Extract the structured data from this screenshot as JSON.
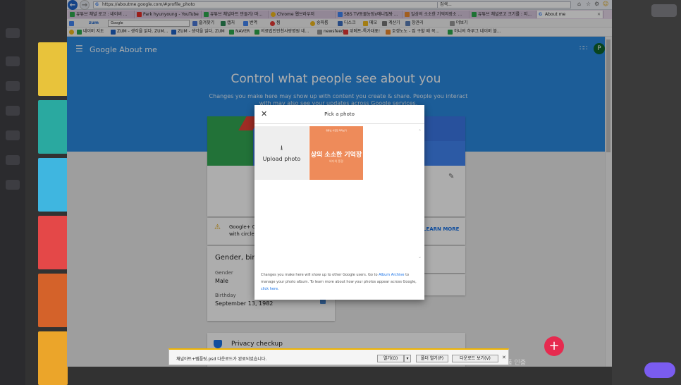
{
  "browser": {
    "url": "https://aboutme.google.com/#profile_photo",
    "search_placeholder": "검색...",
    "tabs": [
      {
        "label": "유튜브 채널 로고 : 네이버 ...",
        "color": "#2fa84f"
      },
      {
        "label": "Park hyunyoung - YouTube",
        "color": "#e52d27"
      },
      {
        "label": "유튜브 채널아트 만들기/ 마...",
        "color": "#2fa84f"
      },
      {
        "label": "Chrome 웹브라우저",
        "color": "#f1b81c"
      },
      {
        "label": "SBS TV동물농장x애니멀봐 ...",
        "color": "#4285f4"
      },
      {
        "label": "일상의 소소한 기억저장소 ...",
        "color": "#ee8b2e"
      },
      {
        "label": "유튜브 채널로고 크기를 : 지...",
        "color": "#2fa84f"
      },
      {
        "label": "About me",
        "color": "#4285f4"
      }
    ],
    "toolbar_items": [
      "zum",
      "Google",
      "즐겨찾기",
      "캡처",
      "번역",
      "찜",
      "송파룸",
      "디스크",
      "메모",
      "계산기",
      "창관리",
      "더보기"
    ],
    "favorites": [
      "네이버 지도",
      "ZUM - 생각을 읽다, ZUM...",
      "ZUM - 생각을 읽다, ZUM",
      "NAVER",
      "의료법인인천사랑병원 네...",
      "newsfeed",
      "위메프-특가대표!",
      "호갱노노 - 집 구할 때 꼭...",
      "하니의 하루그 네이버 블..."
    ]
  },
  "header": {
    "menu_icon": "hamburger-icon",
    "logo": "Google About me",
    "apps_icon": "apps-grid-icon",
    "avatar_letter": "P"
  },
  "hero": {
    "title": "Control what people see about you",
    "subtitle": "Changes you make here may show up with content you create & share. People you interact with may also see your updates across Google services."
  },
  "cards": {
    "google_plus": "Google+ Ci... with circles",
    "learn_more": "LEARN MORE",
    "gender_title": "Gender, birth",
    "gender_label": "Gender",
    "gender_value": "Male",
    "birthday_label": "Birthday",
    "birthday_value": "September 13, 1982",
    "privacy": "Privacy checkup"
  },
  "modal": {
    "title": "Pick a photo",
    "upload_label": "Upload photo",
    "thumb_text": "상의 소소한 기억장",
    "thumb_small": "바다의 풍경",
    "thumb_header": "유튜브 사진첩 미리보기",
    "footer_text_1": "Changes you make here will show up to other Google users. Go to",
    "footer_link_1": "Album Archive",
    "footer_text_2": "to manage your photo album. To learn more about how your photos appear across Google,",
    "footer_link_2": "click here."
  },
  "download": {
    "message": "채널아트+템플릿.psd 다운로드가 완료되었습니다.",
    "open": "열기(O)",
    "open_folder": "폴더 열기(P)",
    "view_downloads": "다운로드 보기(V)"
  },
  "watermark": "Windows 정품 인증",
  "colors": {
    "hero": "#2a8ae1",
    "fab": "#e62a4f",
    "thumb": "#ee8b5a",
    "avatar": "#0d652d"
  }
}
